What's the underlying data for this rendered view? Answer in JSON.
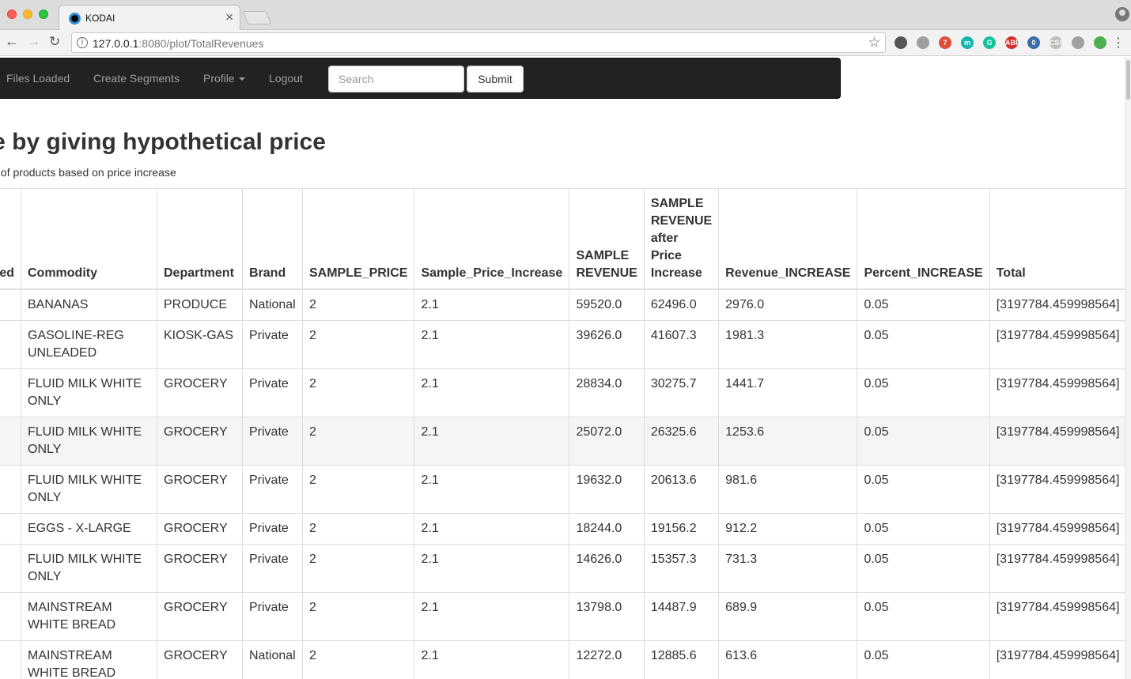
{
  "browser": {
    "tab_title": "KODAI",
    "url_host": "127.0.0.1",
    "url_path": ":8080/plot/TotalRevenues",
    "extensions": [
      {
        "icon": "info-circle-icon",
        "color": "#555555",
        "label": ""
      },
      {
        "icon": "check-icon",
        "color": "#9e9e9e",
        "label": ""
      },
      {
        "icon": "todo-badge-icon",
        "color": "#e04e39",
        "label": "7"
      },
      {
        "icon": "m-extension-icon",
        "color": "#17b4b0",
        "label": "m"
      },
      {
        "icon": "grammarly-icon",
        "color": "#15c39a",
        "label": "G"
      },
      {
        "icon": "adblock-icon",
        "color": "#d32f2f",
        "label": "ABP"
      },
      {
        "icon": "badge-zero-icon",
        "color": "#3b6ea8",
        "label": "0"
      },
      {
        "icon": "css-icon",
        "color": "#bdbdbd",
        "label": "CSS"
      },
      {
        "icon": "tool-icon",
        "color": "#a0a0a0",
        "label": ""
      },
      {
        "icon": "rainbow-icon",
        "color": "#4caf50",
        "label": ""
      }
    ]
  },
  "navbar": {
    "items": [
      {
        "label": "Files Loaded"
      },
      {
        "label": "Create Segments"
      },
      {
        "label": "Profile"
      },
      {
        "label": "Logout"
      }
    ],
    "search_placeholder": "Search",
    "submit_label": "Submit"
  },
  "page": {
    "title": "Total Revenue by giving hypothetical price",
    "subtitle": "Revenue of products based on price increase"
  },
  "table": {
    "columns": [
      "ed",
      "Commodity",
      "Department",
      "Brand",
      "SAMPLE_PRICE",
      "Sample_Price_Increase",
      "SAMPLE REVENUE",
      "SAMPLE REVENUE after Price Increase",
      "Revenue_INCREASE",
      "Percent_INCREASE",
      "Total"
    ],
    "rows": [
      [
        "",
        "BANANAS",
        "PRODUCE",
        "National",
        "2",
        "2.1",
        "59520.0",
        "62496.0",
        "2976.0",
        "0.05",
        "[3197784.459998564]"
      ],
      [
        "",
        "GASOLINE-REG UNLEADED",
        "KIOSK-GAS",
        "Private",
        "2",
        "2.1",
        "39626.0",
        "41607.3",
        "1981.3",
        "0.05",
        "[3197784.459998564]"
      ],
      [
        "",
        "FLUID MILK WHITE ONLY",
        "GROCERY",
        "Private",
        "2",
        "2.1",
        "28834.0",
        "30275.7",
        "1441.7",
        "0.05",
        "[3197784.459998564]"
      ],
      [
        "",
        "FLUID MILK WHITE ONLY",
        "GROCERY",
        "Private",
        "2",
        "2.1",
        "25072.0",
        "26325.6",
        "1253.6",
        "0.05",
        "[3197784.459998564]"
      ],
      [
        "",
        "FLUID MILK WHITE ONLY",
        "GROCERY",
        "Private",
        "2",
        "2.1",
        "19632.0",
        "20613.6",
        "981.6",
        "0.05",
        "[3197784.459998564]"
      ],
      [
        "",
        "EGGS - X-LARGE",
        "GROCERY",
        "Private",
        "2",
        "2.1",
        "18244.0",
        "19156.2",
        "912.2",
        "0.05",
        "[3197784.459998564]"
      ],
      [
        "",
        "FLUID MILK WHITE ONLY",
        "GROCERY",
        "Private",
        "2",
        "2.1",
        "14626.0",
        "15357.3",
        "731.3",
        "0.05",
        "[3197784.459998564]"
      ],
      [
        "",
        "MAINSTREAM WHITE BREAD",
        "GROCERY",
        "Private",
        "2",
        "2.1",
        "13798.0",
        "14487.9",
        "689.9",
        "0.05",
        "[3197784.459998564]"
      ],
      [
        "",
        "MAINSTREAM WHITE BREAD",
        "GROCERY",
        "National",
        "2",
        "2.1",
        "12272.0",
        "12885.6",
        "613.6",
        "0.05",
        "[3197784.459998564]"
      ]
    ]
  },
  "badge": {
    "count": "0",
    "color": "#6b1d6e"
  }
}
